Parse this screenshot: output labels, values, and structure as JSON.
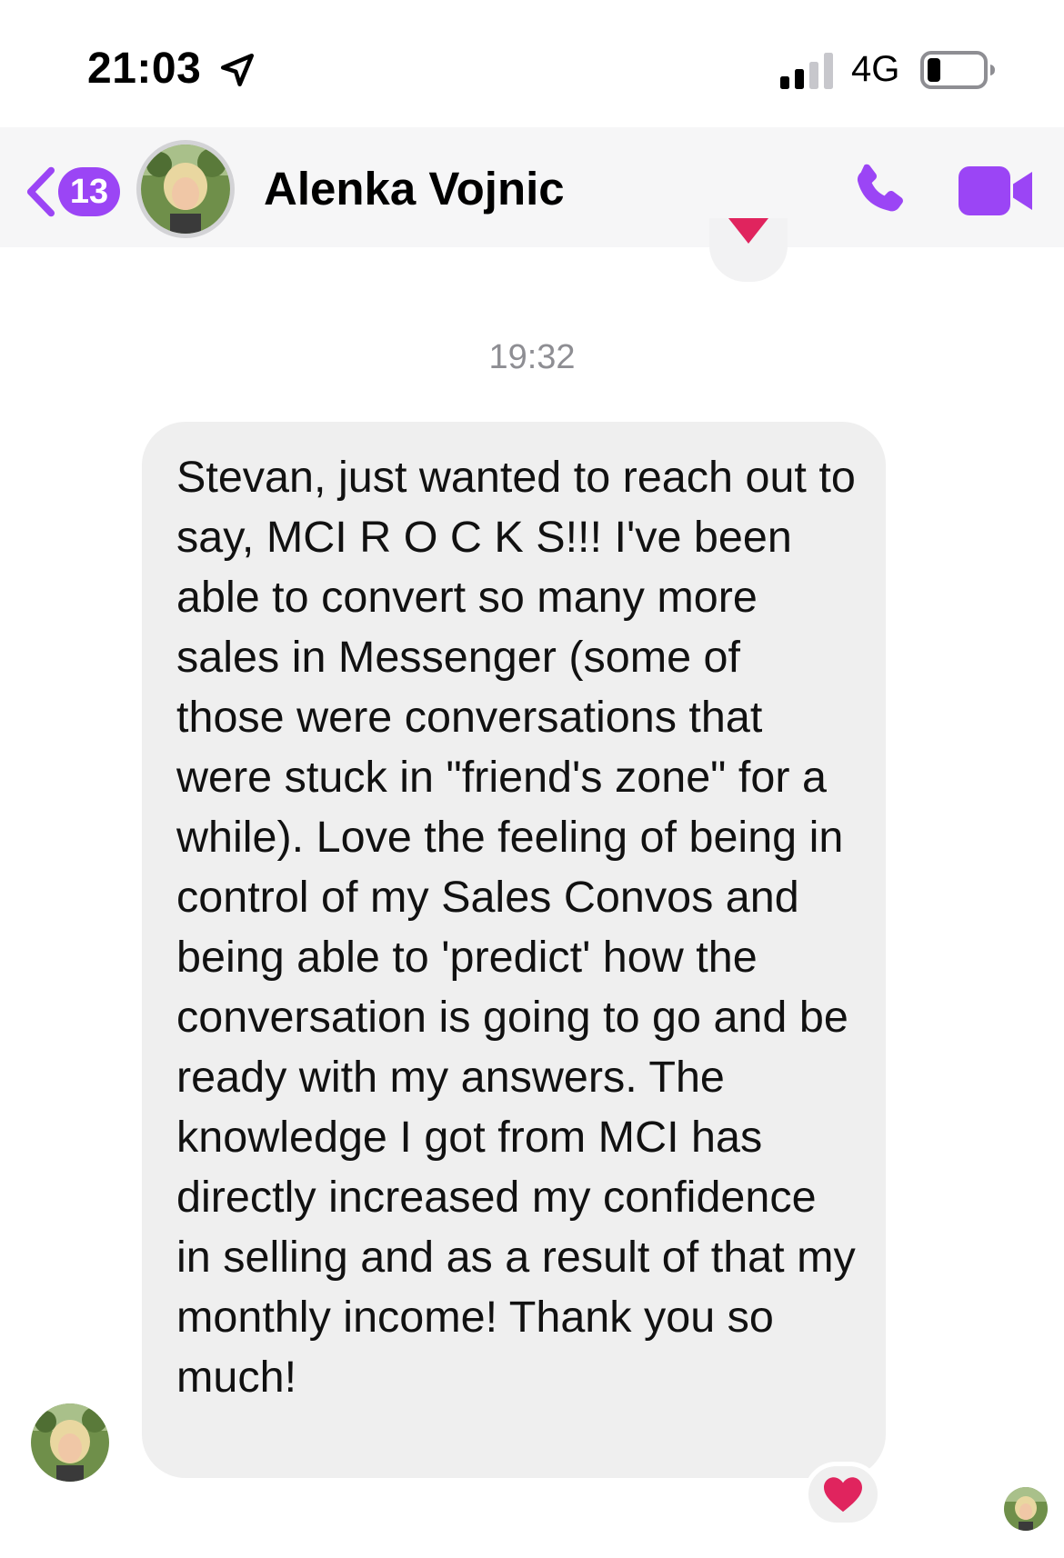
{
  "status_bar": {
    "time": "21:03",
    "network": "4G",
    "icons": [
      "location-arrow-icon",
      "signal-icon",
      "battery-icon"
    ]
  },
  "header": {
    "back_badge": "13",
    "contact_name": "Alenka Vojnic",
    "icons": [
      "back-chevron-icon",
      "phone-icon",
      "video-camera-icon"
    ],
    "accent_color": "#9b45f5"
  },
  "conversation": {
    "timestamp": "19:32",
    "message": "Stevan, just wanted to reach out to say, MCI R O C K S!!! I've been able to convert so many more sales in Messenger (some of those were conversations that were stuck in \"friend's zone\" for a while). Love the feeling of being in control of my Sales Convos and being able to 'predict' how the conversation is going to go and be ready with my answers. The knowledge I got from MCI has directly increased my confidence in selling and as a result of that my monthly income! Thank you so much!",
    "reaction": "heart",
    "bubble_color": "#efefef"
  }
}
